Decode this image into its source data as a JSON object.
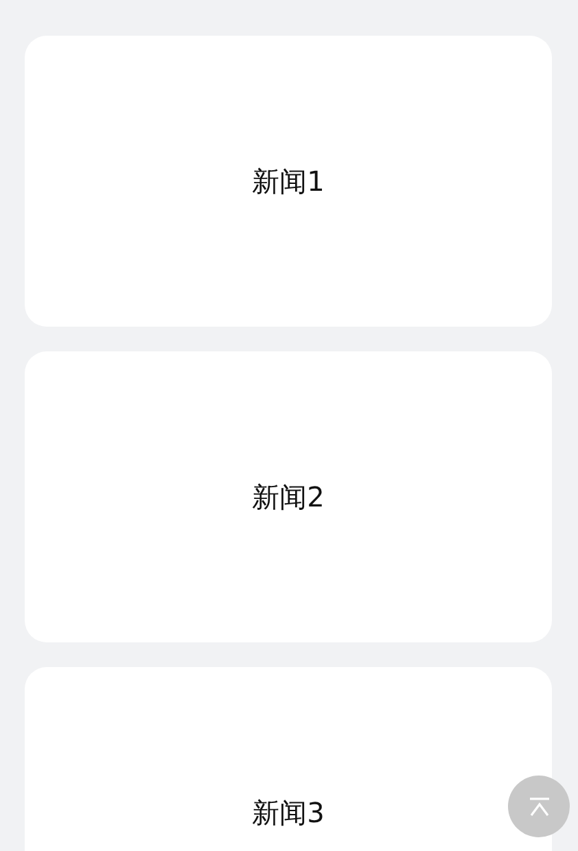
{
  "cards": [
    {
      "title": "新闻1"
    },
    {
      "title": "新闻2"
    },
    {
      "title": "新闻3"
    }
  ],
  "back_to_top": {
    "kind": "icon"
  }
}
